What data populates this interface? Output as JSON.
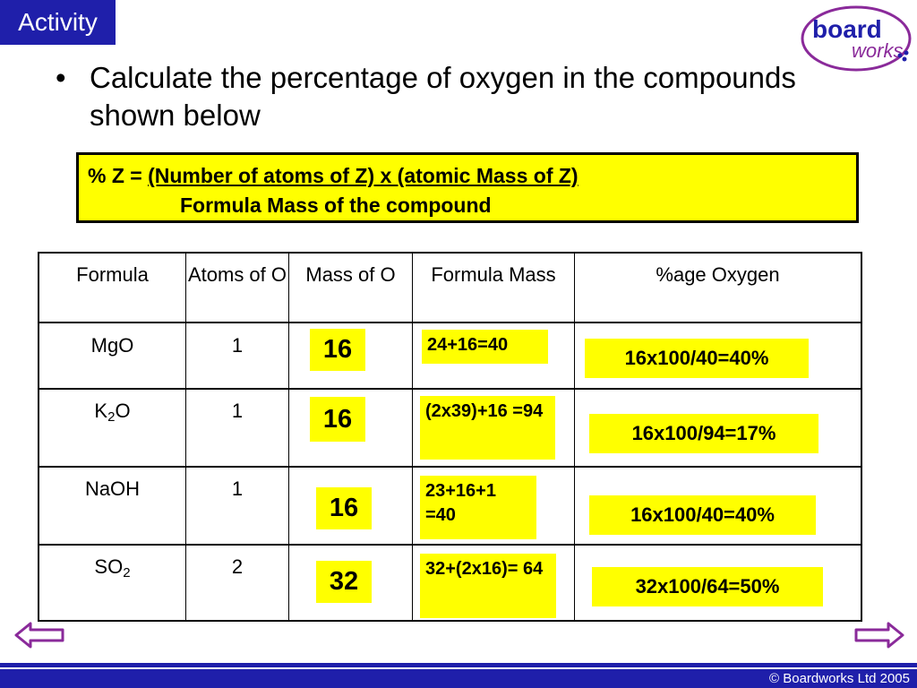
{
  "header": {
    "activity_label": "Activity"
  },
  "logo": {
    "word1": "board",
    "word2": "works"
  },
  "bullet": {
    "glyph": "•",
    "text": "Calculate the percentage of oxygen in the compounds shown below"
  },
  "formula": {
    "prefix": "% Z = ",
    "numerator": "(Number of atoms of Z)  x (atomic Mass of Z)",
    "denominator": "Formula Mass of the compound"
  },
  "table": {
    "headers": [
      "Formula",
      "Atoms of O",
      "Mass of O",
      "Formula Mass",
      "%age Oxygen"
    ],
    "rows": [
      {
        "formula": "MgO",
        "formula_base": "MgO",
        "formula_sub": "",
        "formula_tail": "",
        "atoms": "1",
        "mass": "16",
        "formula_mass": "24+16=40",
        "percent": "16x100/40=40%"
      },
      {
        "formula": "K2O",
        "formula_base": "K",
        "formula_sub": "2",
        "formula_tail": "O",
        "atoms": "1",
        "mass": "16",
        "formula_mass": "(2x39)+16 =94",
        "percent": "16x100/94=17%"
      },
      {
        "formula": "NaOH",
        "formula_base": "NaOH",
        "formula_sub": "",
        "formula_tail": "",
        "atoms": "1",
        "mass": "16",
        "formula_mass": "23+16+1 =40",
        "percent": "16x100/40=40%"
      },
      {
        "formula": "SO2",
        "formula_base": "SO",
        "formula_sub": "2",
        "formula_tail": "",
        "atoms": "2",
        "mass": "32",
        "formula_mass": "32+(2x16)= 64",
        "percent": "32x100/64=50%"
      }
    ]
  },
  "footer": {
    "copyright": "© Boardworks Ltd 2005"
  },
  "colors": {
    "brand_blue": "#1f1faa",
    "highlight": "#ffff00",
    "logo_purple": "#8a2a9a"
  }
}
